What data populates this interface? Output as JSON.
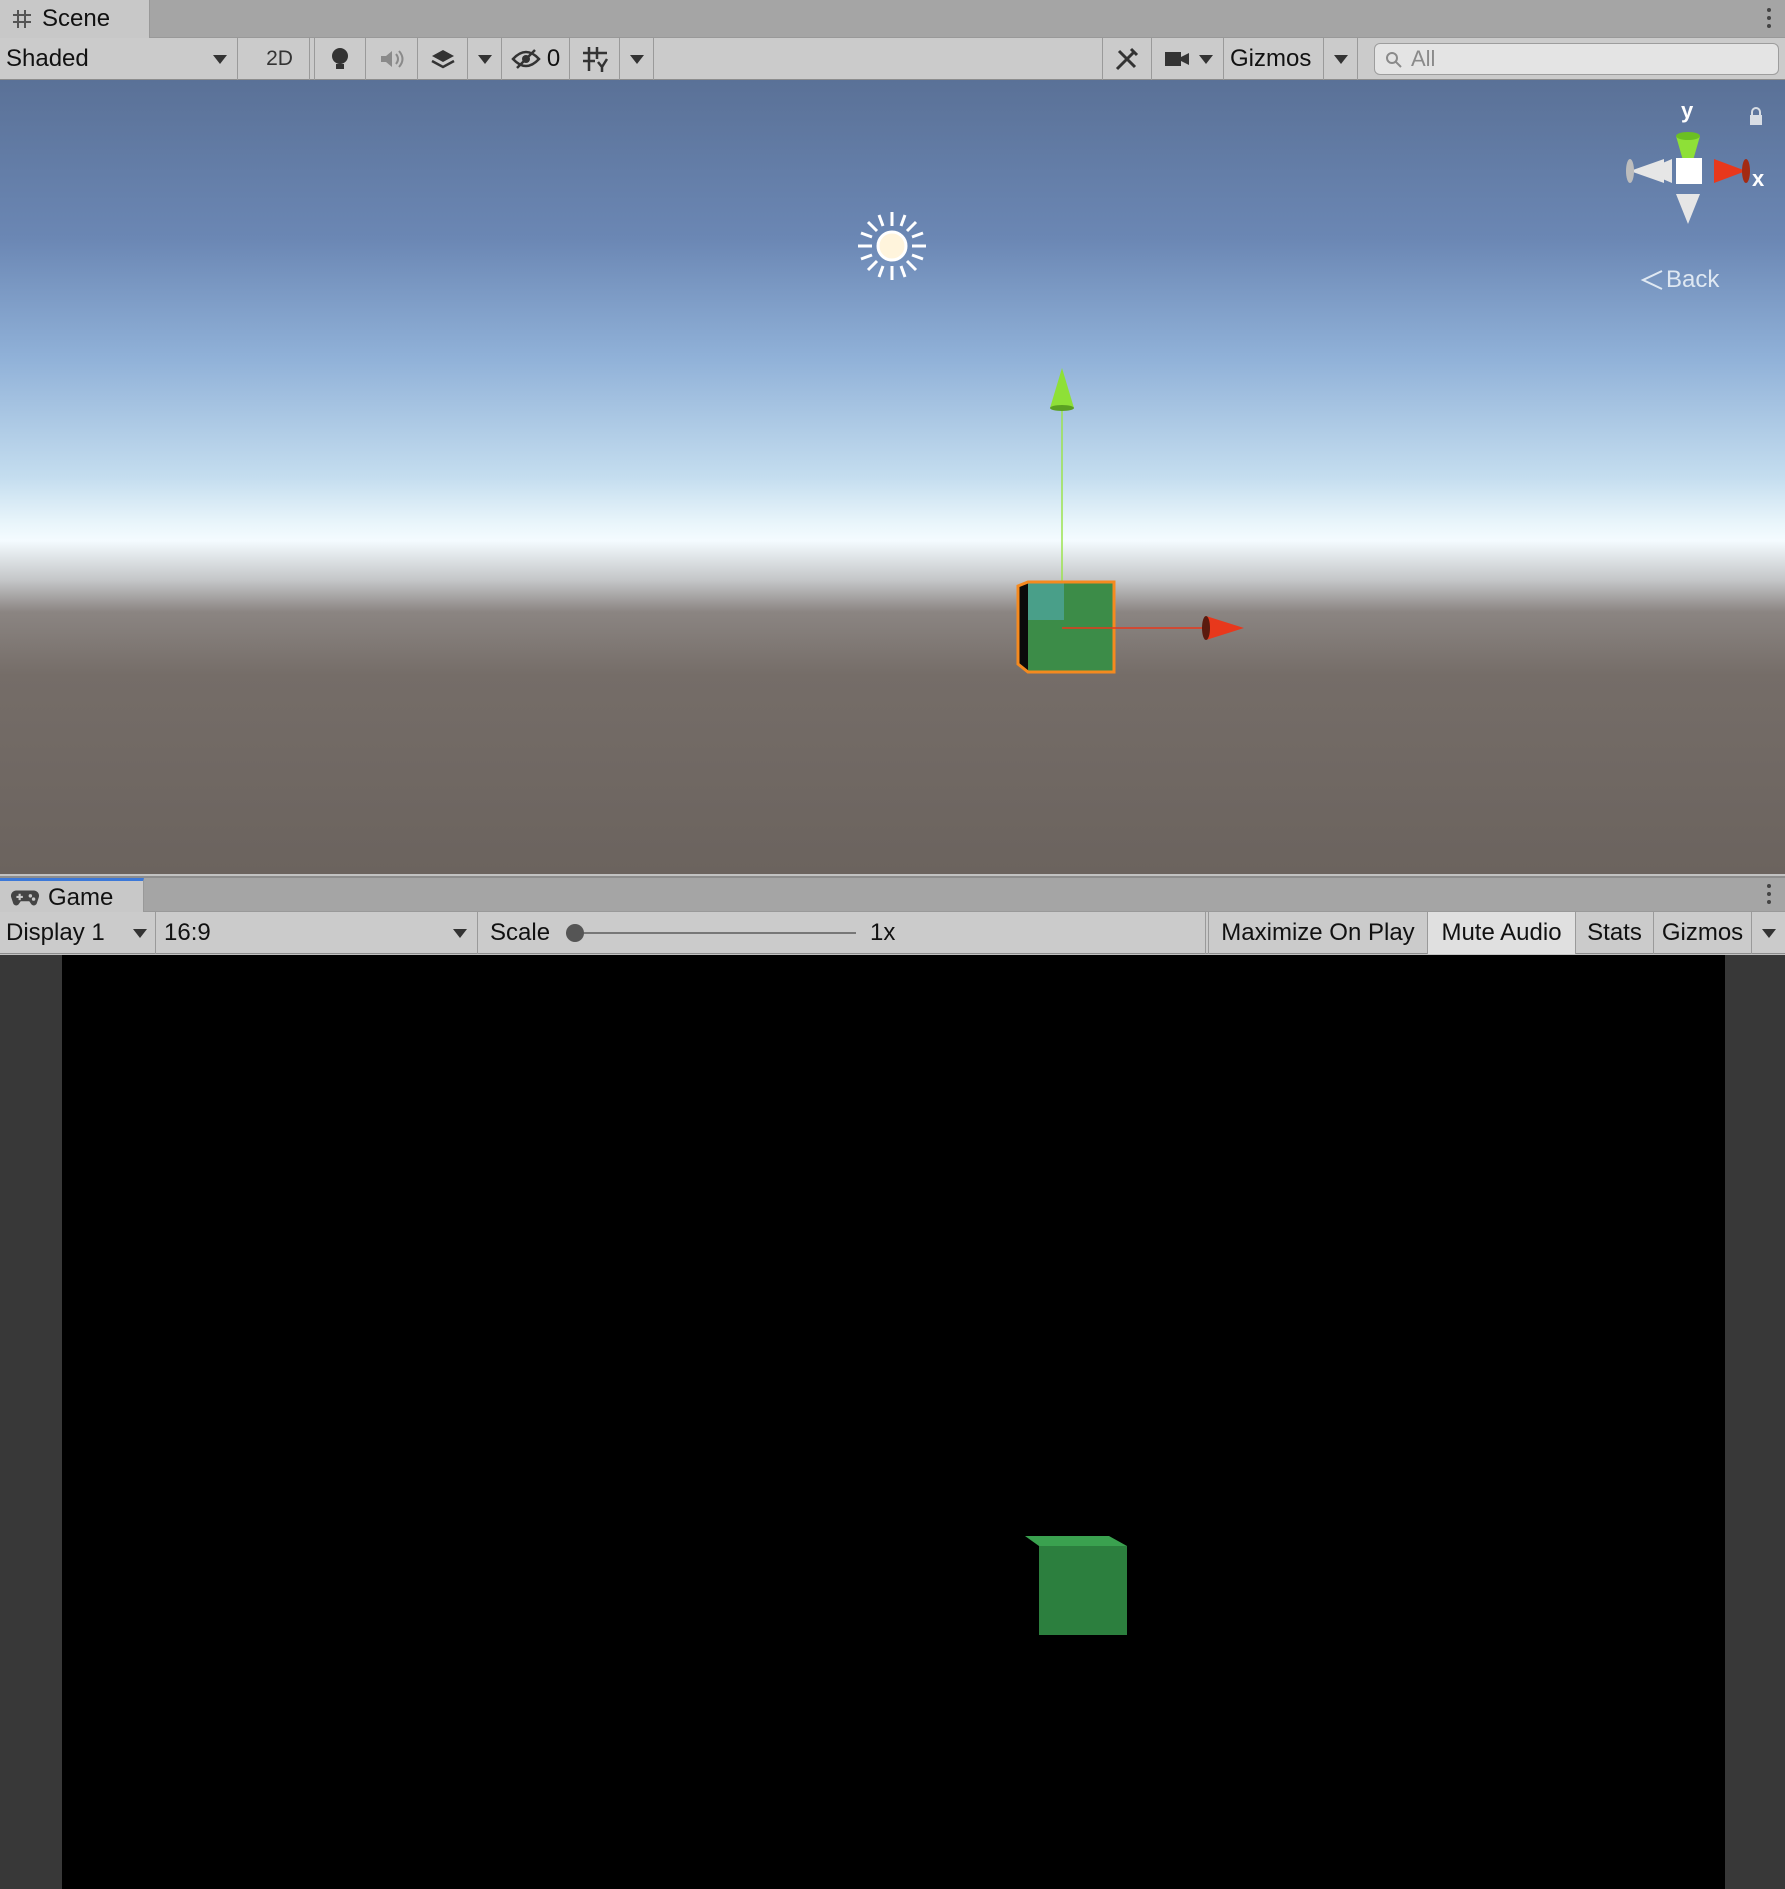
{
  "scene": {
    "tab_label": "Scene",
    "tab_icon": "grid-hash-icon",
    "draw_mode": "Shaded",
    "mode_2d": "2D",
    "hidden_count": "0",
    "gizmos_label": "Gizmos",
    "search_placeholder": "All",
    "axis_y_label": "y",
    "axis_x_label": "x",
    "view_label": "Back",
    "colors": {
      "selection_outline": "#f58a1f",
      "cube": "#3f9a4d",
      "axis_x": "#e8381c",
      "axis_y": "#8ee037"
    }
  },
  "game": {
    "tab_label": "Game",
    "tab_icon": "gamepad-icon",
    "display": "Display 1",
    "aspect": "16:9",
    "scale_label": "Scale",
    "scale_value": "1x",
    "scale_fraction": 0,
    "maximize_on_play": "Maximize On Play",
    "mute_audio": "Mute Audio",
    "stats": "Stats",
    "gizmos_label": "Gizmos",
    "colors": {
      "cube_front": "#2c7f3e",
      "cube_top": "#3aa14f",
      "background": "#000000"
    }
  }
}
